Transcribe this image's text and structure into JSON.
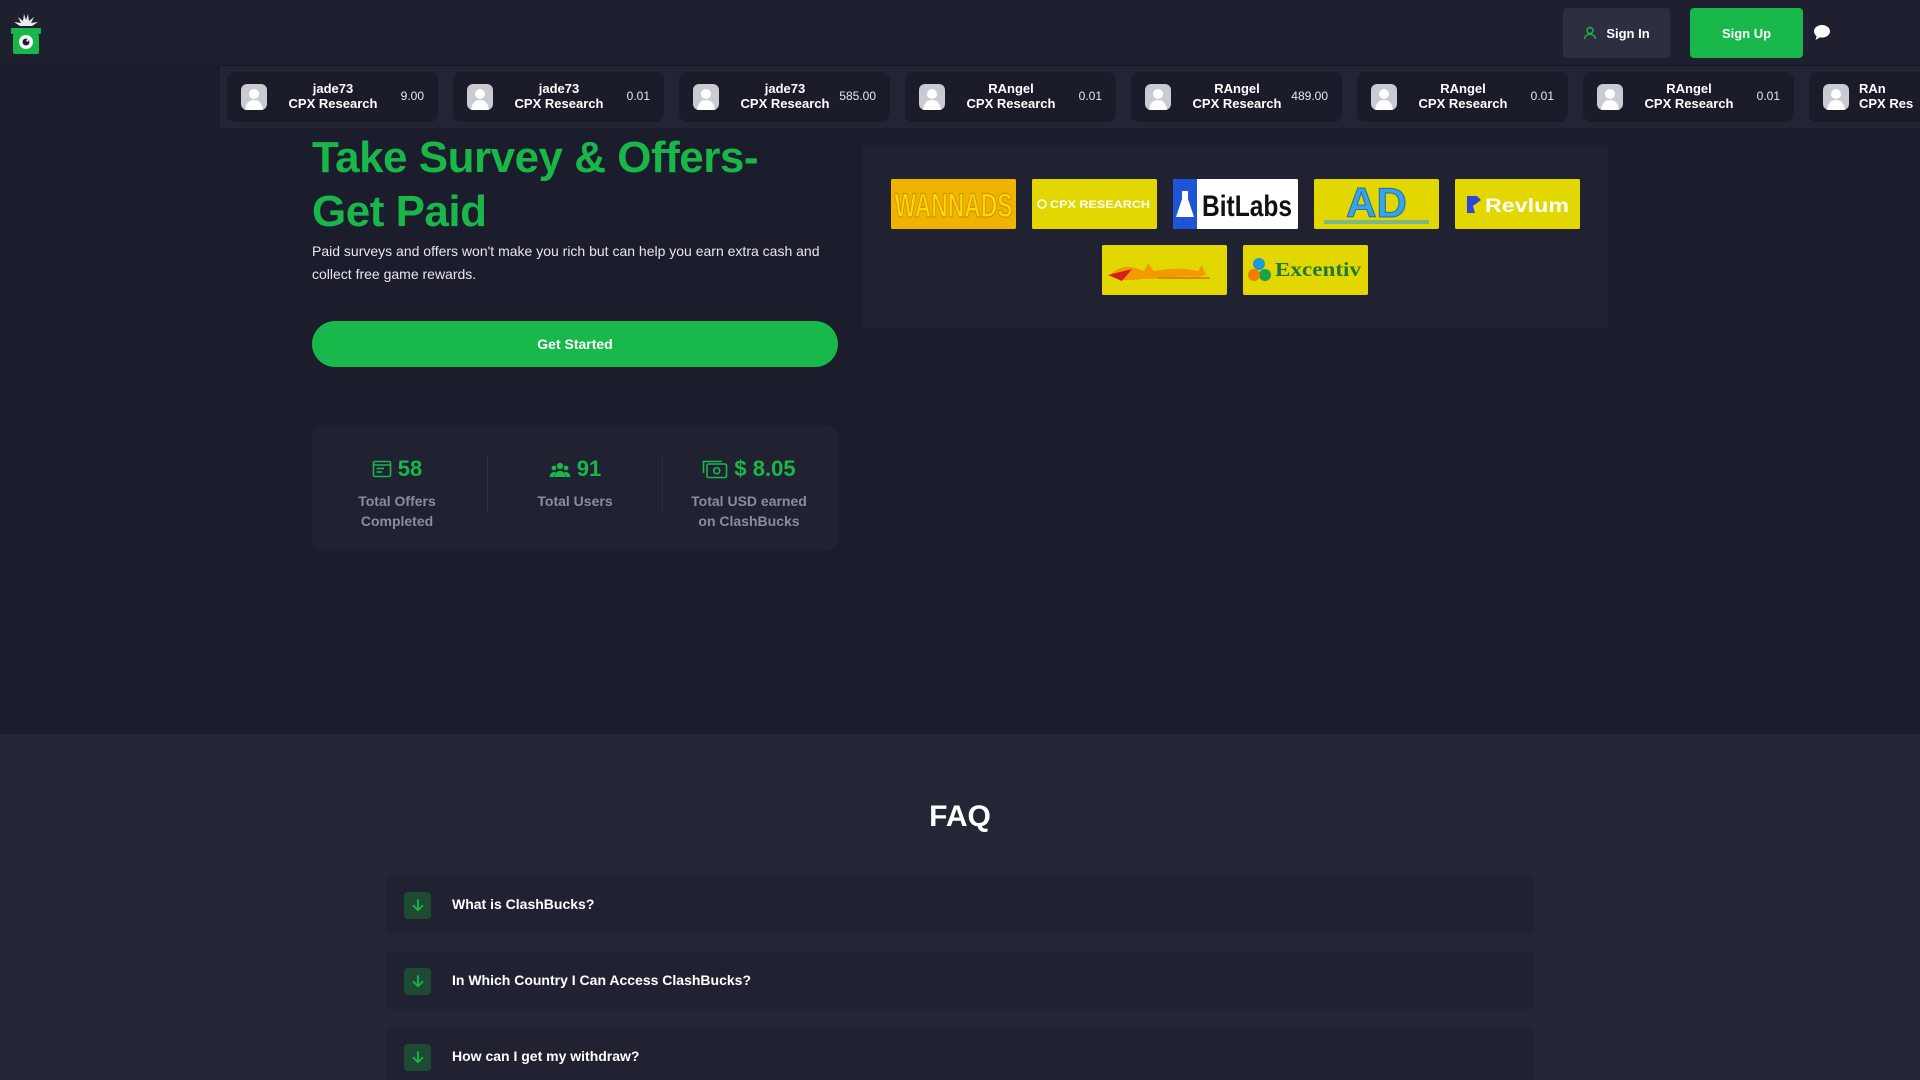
{
  "header": {
    "logo": "gift-box-logo",
    "signin_label": "Sign In",
    "signup_label": "Sign Up",
    "chat_icon": "chat-bubble-icon"
  },
  "ticker": [
    {
      "user": "jade73",
      "offerwall": "CPX Research",
      "amount": "9.00"
    },
    {
      "user": "jade73",
      "offerwall": "CPX Research",
      "amount": "0.01"
    },
    {
      "user": "jade73",
      "offerwall": "CPX Research",
      "amount": "585.00"
    },
    {
      "user": "RAngel",
      "offerwall": "CPX Research",
      "amount": "0.01"
    },
    {
      "user": "RAngel",
      "offerwall": "CPX Research",
      "amount": "489.00"
    },
    {
      "user": "RAngel",
      "offerwall": "CPX Research",
      "amount": "0.01"
    },
    {
      "user": "RAngel",
      "offerwall": "CPX Research",
      "amount": "0.01"
    },
    {
      "user": "RAn",
      "offerwall": "CPX Res",
      "amount": ""
    }
  ],
  "hero": {
    "title_line1": "Take Survey & Offers-",
    "title_line2": "Get Paid",
    "description": "Paid surveys and offers won't make you rich but can help you earn extra cash and collect free game rewards.",
    "cta_label": "Get Started"
  },
  "stats": [
    {
      "icon": "offers-list-icon",
      "value": "58",
      "label": "Total Offers Completed"
    },
    {
      "icon": "users-group-icon",
      "value": "91",
      "label": "Total Users"
    },
    {
      "icon": "money-icon",
      "value": "$ 8.05",
      "label": "Total USD earned on ClashBucks"
    }
  ],
  "partners": [
    {
      "name": "wannads",
      "text": "WANNADS"
    },
    {
      "name": "cpx-research",
      "text": "CPX RESEARCH"
    },
    {
      "name": "bitlabs",
      "text": "BitLabs"
    },
    {
      "name": "adswedmedia",
      "text": "AD"
    },
    {
      "name": "revlum",
      "text": "Revlum"
    },
    {
      "name": "timewall",
      "text": ""
    },
    {
      "name": "excentiv",
      "text": "Excentiv"
    }
  ],
  "faq": {
    "title": "FAQ",
    "items": [
      {
        "question": "What is ClashBucks?"
      },
      {
        "question": "In Which Country I Can Access ClashBucks?"
      },
      {
        "question": "How can I get my withdraw?"
      }
    ]
  },
  "colors": {
    "accent": "#18b84a",
    "background": "#1b1d2c",
    "panel": "#202232",
    "partner_yellow": "#e3d700"
  }
}
